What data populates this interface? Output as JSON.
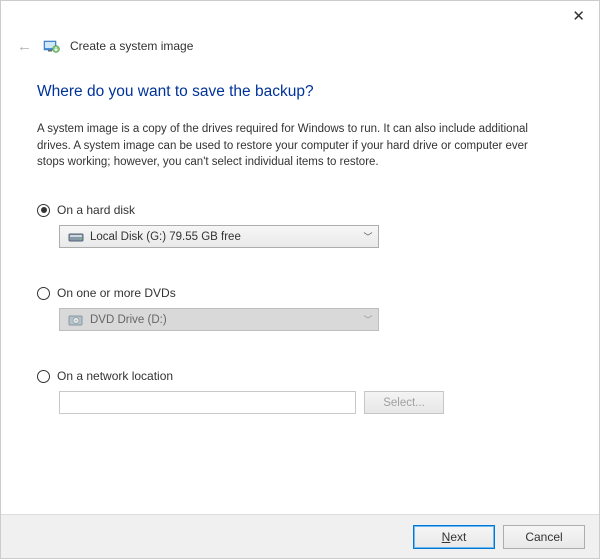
{
  "window": {
    "title": "Create a system image"
  },
  "page": {
    "heading": "Where do you want to save the backup?",
    "description": "A system image is a copy of the drives required for Windows to run. It can also include additional drives. A system image can be used to restore your computer if your hard drive or computer ever stops working; however, you can't select individual items to restore."
  },
  "options": {
    "hard_disk": {
      "label": "On a hard disk",
      "selected": true,
      "value": "Local Disk (G:)  79.55 GB free"
    },
    "dvd": {
      "label": "On one or more DVDs",
      "selected": false,
      "value": "DVD Drive (D:)"
    },
    "network": {
      "label": "On a network location",
      "selected": false,
      "value": "",
      "select_button": "Select..."
    }
  },
  "footer": {
    "next": "Next",
    "cancel": "Cancel"
  }
}
